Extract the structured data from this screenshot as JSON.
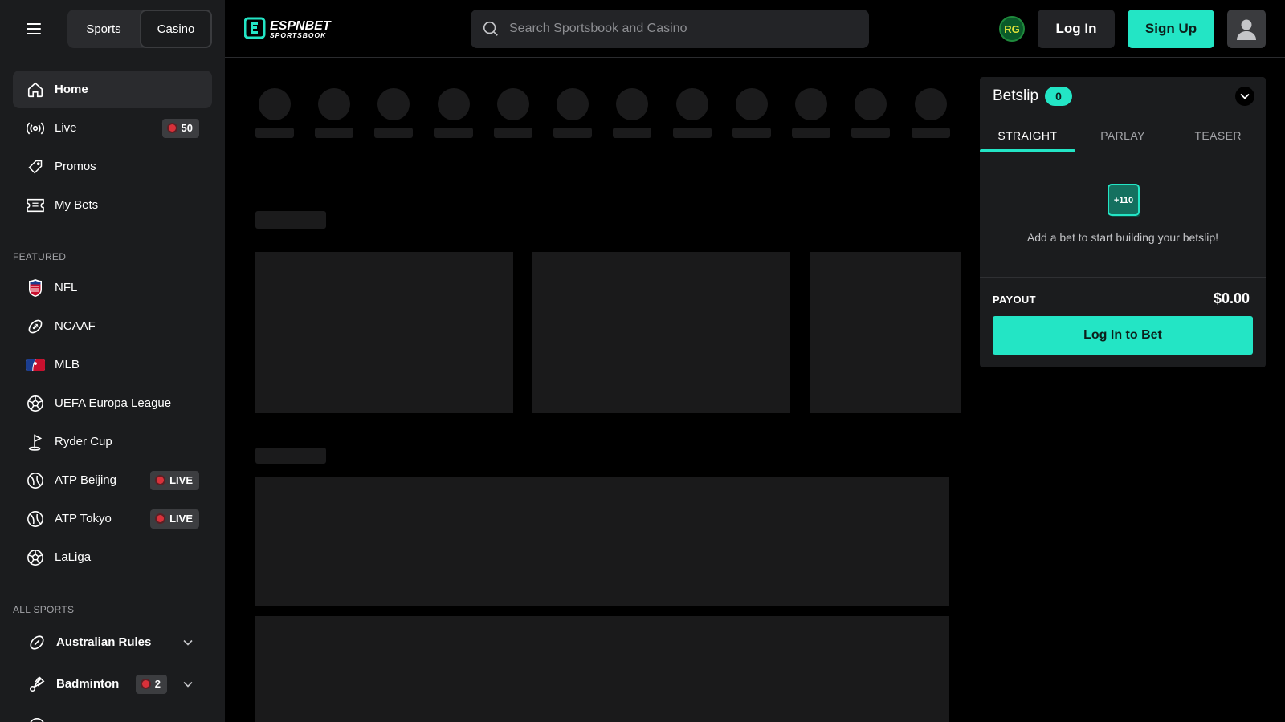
{
  "header": {
    "product_toggle": [
      "Sports",
      "Casino"
    ],
    "logo_text": [
      "ESPNBET",
      "SPORTSBOOK"
    ],
    "search_placeholder": "Search Sportsbook and Casino",
    "rg_label": "RG",
    "login_label": "Log In",
    "signup_label": "Sign Up"
  },
  "sidebar": {
    "main": [
      {
        "label": "Home",
        "icon": "home-icon"
      },
      {
        "label": "Live",
        "icon": "live-icon",
        "badge": "50"
      },
      {
        "label": "Promos",
        "icon": "tag-icon"
      },
      {
        "label": "My Bets",
        "icon": "ticket-icon"
      }
    ],
    "featured_label": "FEATURED",
    "featured": [
      {
        "label": "NFL",
        "icon": "nfl-icon"
      },
      {
        "label": "NCAAF",
        "icon": "football-icon"
      },
      {
        "label": "MLB",
        "icon": "mlb-icon"
      },
      {
        "label": "UEFA Europa League",
        "icon": "soccer-icon"
      },
      {
        "label": "Ryder Cup",
        "icon": "golf-icon"
      },
      {
        "label": "ATP Beijing",
        "icon": "tennis-icon",
        "badge": "LIVE"
      },
      {
        "label": "ATP Tokyo",
        "icon": "tennis-icon",
        "badge": "LIVE"
      },
      {
        "label": "LaLiga",
        "icon": "soccer-icon"
      }
    ],
    "all_sports_label": "ALL SPORTS",
    "all_sports": [
      {
        "label": "Australian Rules",
        "icon": "aussie-football-icon"
      },
      {
        "label": "Badminton",
        "icon": "shuttlecock-icon",
        "badge": "2"
      }
    ]
  },
  "betslip": {
    "title": "Betslip",
    "count": "0",
    "tabs": [
      "STRAIGHT",
      "PARLAY",
      "TEASER"
    ],
    "empty_odds": "+110",
    "empty_text": "Add a bet to start building your betslip!",
    "payout_label": "PAYOUT",
    "payout_value": "$0.00",
    "bet_button": "Log In to Bet"
  },
  "colors": {
    "accent": "#23e5c5",
    "sidebar_bg": "#1b1c1e",
    "page_bg": "#000000",
    "live_dot": "#d8313a"
  }
}
